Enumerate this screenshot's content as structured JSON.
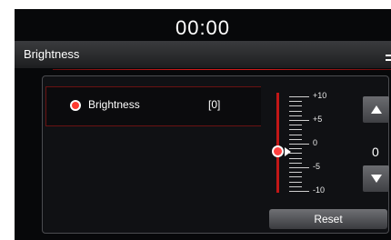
{
  "status_bar": {
    "clock": "00:00"
  },
  "header": {
    "title": "Brightness"
  },
  "setting_row": {
    "label": "Brightness",
    "value": "[0]"
  },
  "slider": {
    "tick_labels": [
      "+10",
      "+5",
      "0",
      "-5",
      "-10"
    ],
    "min": -10,
    "max": 10,
    "current": 0,
    "current_display": "0"
  },
  "buttons": {
    "reset_label": "Reset"
  },
  "colors": {
    "accent": "#d21b1b",
    "background": "#07080a",
    "panel": "#101114"
  },
  "icons": {
    "back": "back-icon",
    "up": "arrow-up-icon",
    "down": "arrow-down-icon",
    "bullet": "radio-dot-icon"
  }
}
